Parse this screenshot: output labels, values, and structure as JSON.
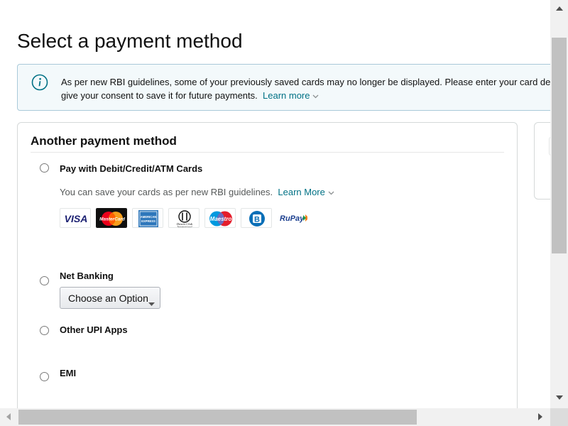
{
  "page": {
    "title": "Select a payment method"
  },
  "notice": {
    "icon": "info-icon",
    "line1": "As per new RBI guidelines, some of your previously saved cards may no longer be displayed. Please enter your card details and",
    "line2": "give your consent to save it for future payments.",
    "link_label": "Learn more"
  },
  "payment_section": {
    "heading": "Another payment method",
    "options": [
      {
        "label": "Pay with Debit/Credit/ATM Cards",
        "selected": false,
        "helper_text": "You can save your cards as per new RBI guidelines.",
        "helper_link": "Learn More",
        "card_logos": [
          {
            "name": "visa-logo",
            "text": "VISA"
          },
          {
            "name": "mastercard-logo",
            "text": "MasterCard"
          },
          {
            "name": "american-express-logo",
            "text": "AMERICAN EXPRESS"
          },
          {
            "name": "diners-club-logo",
            "text": "Diners Club International"
          },
          {
            "name": "maestro-logo",
            "text": "Maestro"
          },
          {
            "name": "bajaj-finserv-logo",
            "text": "B"
          },
          {
            "name": "rupay-logo",
            "text": "RuPay"
          }
        ]
      },
      {
        "label": "Net Banking",
        "selected": false,
        "select": {
          "value": "Choose an Option"
        }
      },
      {
        "label": "Other UPI Apps",
        "selected": false
      },
      {
        "label": "EMI",
        "selected": false
      }
    ]
  },
  "colors": {
    "link": "#007185",
    "notice_border": "#a9c9d9",
    "notice_background": "#f3f9fb",
    "card_border": "#d5d9d9",
    "info_icon": "#007185"
  },
  "scrollbars": {
    "vertical_position": 0.19,
    "horizontal_position": 0.0
  }
}
